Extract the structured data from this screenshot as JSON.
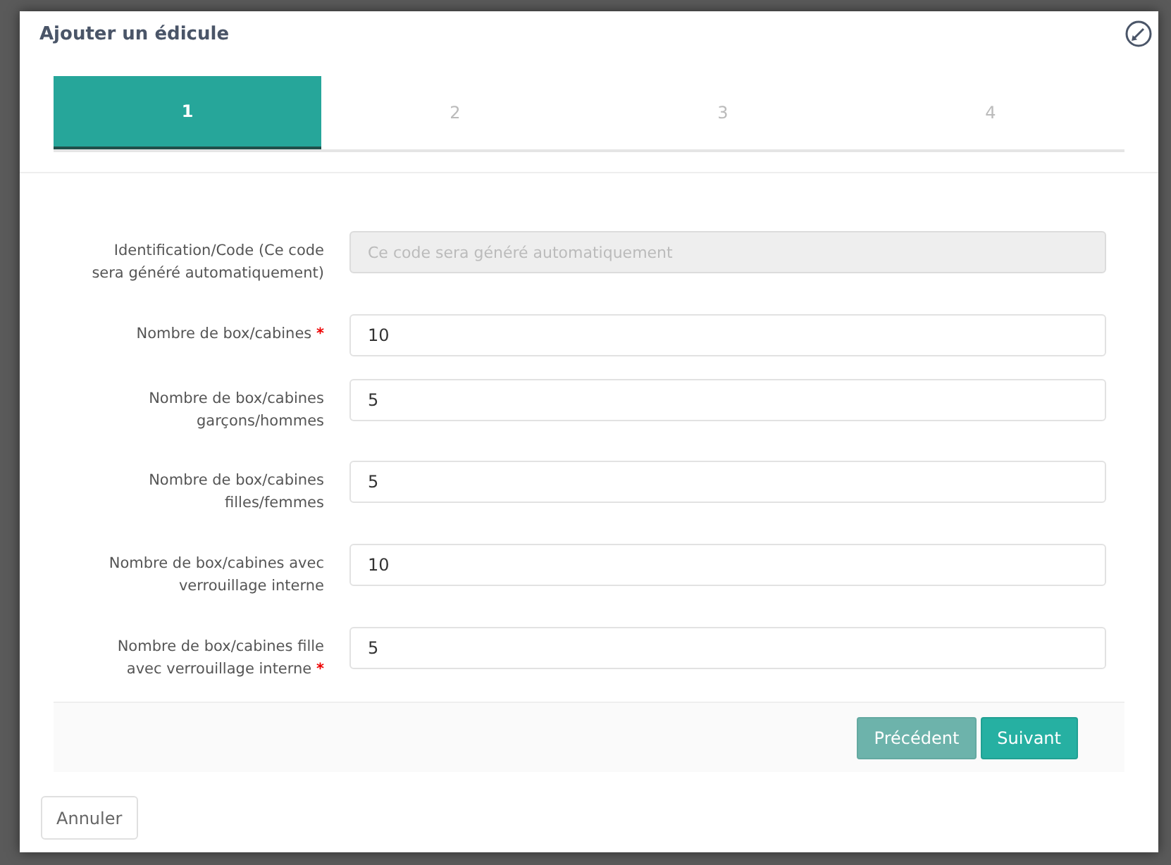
{
  "dialog": {
    "title": "Ajouter un édicule"
  },
  "steps": [
    {
      "label": "1",
      "selected": true
    },
    {
      "label": "2",
      "selected": false
    },
    {
      "label": "3",
      "selected": false
    },
    {
      "label": "4",
      "selected": false
    }
  ],
  "fields": [
    {
      "label": "Identification/Code (Ce code sera généré automatiquement)",
      "disabled": true,
      "placeholder": "Ce code sera généré automatiquement"
    },
    {
      "label": "Nombre de box/cabines",
      "required_mark": "*",
      "disabled": false,
      "value": "10"
    },
    {
      "label": "Nombre de box/cabines garçons/hommes",
      "disabled": false,
      "value": "5"
    },
    {
      "label": "Nombre de box/cabines filles/femmes",
      "disabled": false,
      "value": "5"
    },
    {
      "label": "Nombre de box/cabines avec verrouillage interne",
      "disabled": false,
      "value": "10"
    },
    {
      "label": "Nombre de box/cabines fille avec verrouillage interne",
      "required_mark": "*",
      "disabled": false,
      "value": "5"
    }
  ],
  "wizard_buttons": [
    {
      "label": "Précédent",
      "disabled": true
    },
    {
      "label": "Suivant",
      "disabled": false
    }
  ],
  "cancel_button": {
    "label": "Annuler"
  }
}
